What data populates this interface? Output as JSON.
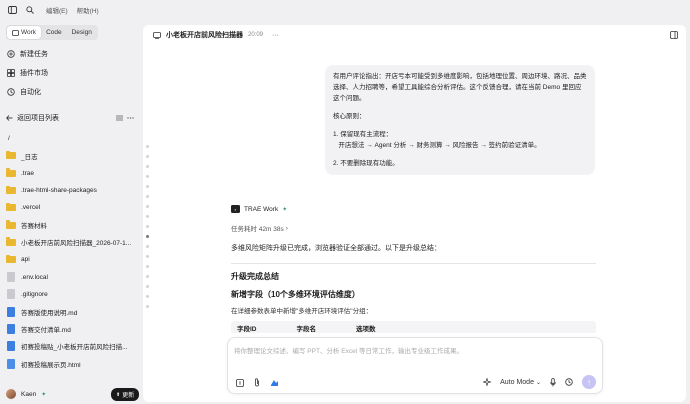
{
  "menu": {
    "edit": "编辑(E)",
    "help": "帮助(H)"
  },
  "modes": [
    {
      "label": "Work"
    },
    {
      "label": "Code"
    },
    {
      "label": "Design"
    }
  ],
  "nav": {
    "new_task": "新建任务",
    "plugins": "插件市场",
    "automation": "自动化"
  },
  "project": {
    "back_label": "返回项目列表",
    "root": "/",
    "items": [
      {
        "name": "_日志",
        "type": "folder"
      },
      {
        "name": ".trae",
        "type": "folder"
      },
      {
        "name": ".trae-html-share-packages",
        "type": "folder"
      },
      {
        "name": ".vercel",
        "type": "folder"
      },
      {
        "name": "答赛材料",
        "type": "folder"
      },
      {
        "name": "小老板开店前风险扫描器_2026-07-1...",
        "type": "folder"
      },
      {
        "name": "api",
        "type": "folder"
      },
      {
        "name": ".env.local",
        "type": "file"
      },
      {
        "name": ".gitignore",
        "type": "file"
      },
      {
        "name": "答赛版使用说明.md",
        "type": "doc"
      },
      {
        "name": "答赛交付清单.md",
        "type": "doc"
      },
      {
        "name": "初赛投稿贴_小老板开店前风险扫描...",
        "type": "doc"
      },
      {
        "name": "初赛投稿展示页.html",
        "type": "html"
      }
    ]
  },
  "user": {
    "name": "Kaen",
    "update_label": "更新"
  },
  "task": {
    "title": "小老板开店前风险扫描器",
    "time": "20:09"
  },
  "user_message": {
    "para1": "有用户评论指出：开店亏本可能受到多维度影响，包括地理位置、周边环境、路况、品类选择、人力招聘等，希望工具能综合分析评估。这个反馈合理，请在当前 Demo 里回应这个问题。",
    "para2": "核心原则：",
    "para3": "1. 保留现有主流程：\n   开店想法 → Agent 分析 → 财务测算 → 风险报告 → 签约前验证清单。",
    "para4": "2. 不要删除现有功能。"
  },
  "agent": {
    "name": "TRAE Work",
    "elapsed": "任务耗时 42m 38s",
    "result": "多维风险矩阵升级已完成，浏览器验证全部通过。以下是升级总结：",
    "heading": "升级完成总结",
    "subheading": "新增字段（10个多维环境评估维度）",
    "paragraph": "在详细参数表单中新增\"多维开店环境评估\"分组：",
    "table_headers": [
      "字段ID",
      "字段名",
      "选项数"
    ]
  },
  "composer": {
    "placeholder": "将你整理论文综述、编写 PPT、分析 Excel 等日常工作，输出专业级工作成果。",
    "mode_label": "Auto Mode"
  }
}
